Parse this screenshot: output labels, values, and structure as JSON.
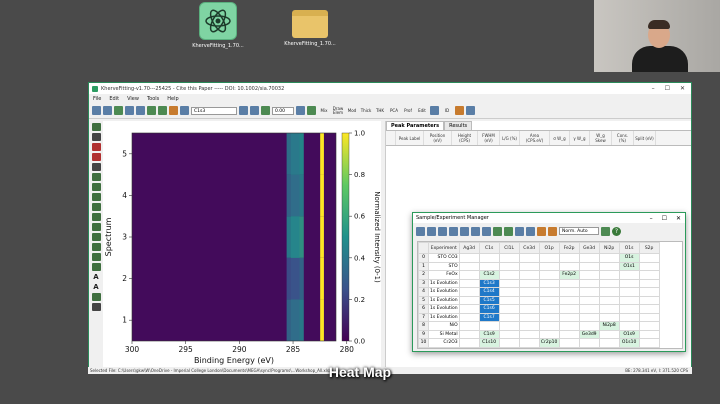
{
  "desktop": {
    "app_icon_label": "KherveFitting_1.70...",
    "folder_icon_label": "KherveFitting_1.70..."
  },
  "window": {
    "title": "KherveFitting-v1.70---25425 - Cite this Paper ----- DOI: 10.1002/sia.70032",
    "menu": [
      "File",
      "Edit",
      "View",
      "Tools",
      "Help"
    ],
    "core_level": "C1s3",
    "offset_value": "0.00",
    "toolbar_labels": [
      "Mix",
      "Draw Elem",
      "Mod",
      "Thick",
      "THK",
      "PCA",
      "Prof",
      "Edit",
      "ID"
    ]
  },
  "plot": {
    "chart_data": {
      "type": "heatmap",
      "xlabel": "Binding Energy (eV)",
      "ylabel": "Spectrum",
      "colorbar_label": "Normalized Intensity (0-1)",
      "x_ticks": [
        300,
        295,
        290,
        285,
        280
      ],
      "y_ticks": [
        1,
        2,
        3,
        4,
        5
      ],
      "colorbar_ticks": [
        "0.0",
        "0.2",
        "0.4",
        "0.6",
        "0.8",
        "1.0"
      ],
      "xlim": [
        300,
        281
      ],
      "ylim": [
        0.5,
        5.5
      ],
      "bands": [
        {
          "center": 284.6,
          "intensity": 0.45
        },
        {
          "center": 285.0,
          "intensity": 0.35
        },
        {
          "center": 282.3,
          "intensity": 1.0
        }
      ]
    },
    "x_tick_labels": [
      "300",
      "295",
      "290",
      "285",
      "280"
    ],
    "y_tick_labels": [
      "1",
      "2",
      "3",
      "4",
      "5"
    ]
  },
  "right_panel": {
    "tabs": [
      "Peak Parameters",
      "Results"
    ],
    "columns": [
      "Peak Label",
      "Position (eV)",
      "Height (CPS)",
      "FWHM (eV)",
      "L/G (%)",
      "Area (CPS.eV)",
      "σ W_g",
      "γ W_g",
      "W_g Skew",
      "Cons. (%)",
      "Split (eV)"
    ]
  },
  "dialog": {
    "title": "Sample/Experiment Manager",
    "mode": "Norm. Auto",
    "help": "?",
    "headers": [
      "",
      "Experiment",
      "Ag3d",
      "C1s",
      "Cl1L",
      "Ce3d",
      "O1p",
      "Fe2p",
      "Ge3d",
      "Ni2p",
      "O1s",
      "S2p"
    ],
    "rows": [
      {
        "n": "0",
        "exp": "STO CO3",
        "cells": {
          "O1s": "O1s"
        }
      },
      {
        "n": "1",
        "exp": "STO",
        "cells": {
          "O1s": "O1s1"
        }
      },
      {
        "n": "2",
        "exp": "FeOx",
        "cells": {
          "C1s": "C1s2",
          "Fe2p": "Fe2p2"
        }
      },
      {
        "n": "3",
        "exp": "1s Evolution",
        "cells": {
          "C1s": "C1s3"
        }
      },
      {
        "n": "4",
        "exp": "1s Evolution",
        "cells": {
          "C1s": "C1s4"
        }
      },
      {
        "n": "5",
        "exp": "1s Evolution",
        "cells": {
          "C1s": "C1s5"
        }
      },
      {
        "n": "6",
        "exp": "1s Evolution",
        "cells": {
          "C1s": "C1s6"
        }
      },
      {
        "n": "7",
        "exp": "1s Evolution",
        "cells": {
          "C1s": "C1s7"
        }
      },
      {
        "n": "8",
        "exp": "NiO",
        "cells": {
          "Ni2p": "Ni2p8"
        }
      },
      {
        "n": "9",
        "exp": "Si Metal",
        "cells": {
          "C1s": "C1s9",
          "Ge3d": "Ge3d9",
          "O1s": "O1s9"
        }
      },
      {
        "n": "10",
        "exp": "Cr2O3",
        "cells": {
          "C1s": "C1s10",
          "O1p": "Cr2p10",
          "O1s": "O1s10"
        }
      }
    ]
  },
  "status_bar": {
    "left": "Selected File: C:\\Users\\gkw\\W\\OneDrive - Imperial College London\\Documents\\MEGA\\sync\\Programs\\...Workshop_All.xlsx",
    "right": "BE: 278.341 eV, I: 371.520 CPS"
  },
  "caption": "Heat Map"
}
